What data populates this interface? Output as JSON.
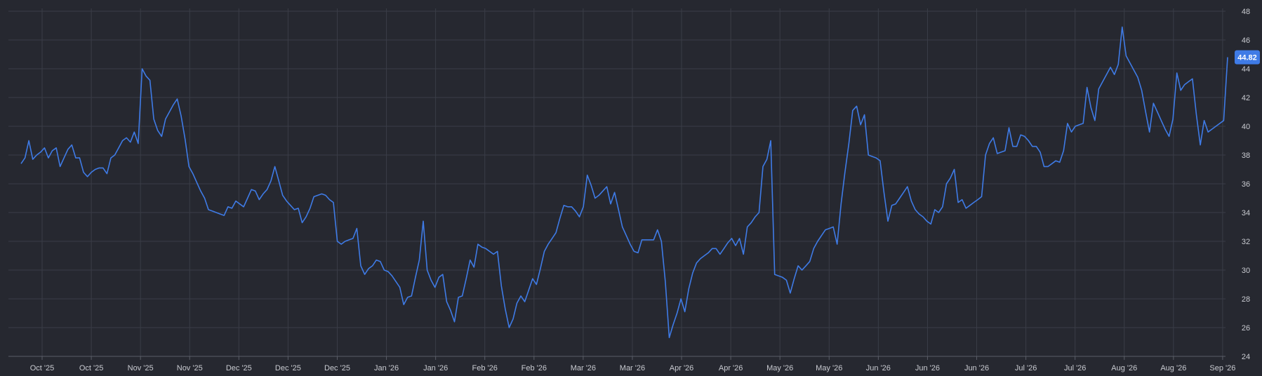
{
  "colors": {
    "background": "#262830",
    "line": "#3f7be6",
    "grid": "#3a3d47",
    "text": "#c9cbd1",
    "badge": "#3f7be6"
  },
  "chart_data": {
    "type": "line",
    "title": "",
    "xlabel": "",
    "ylabel": "",
    "ylim": [
      24,
      48
    ],
    "y_ticks": [
      24,
      26,
      28,
      30,
      32,
      34,
      36,
      38,
      40,
      42,
      44,
      46,
      48
    ],
    "y_axis_position": "right",
    "grid": true,
    "x_ticks": [
      "Oct '25",
      "Oct '25",
      "Nov '25",
      "Nov '25",
      "Dec '25",
      "Dec '25",
      "Dec '25",
      "Jan '26",
      "Jan '26",
      "Feb '26",
      "Feb '26",
      "Mar '26",
      "Mar '26",
      "Apr '26",
      "Apr '26",
      "May '26",
      "May '26",
      "Jun '26",
      "Jun '26",
      "Jun '26",
      "Jul '26",
      "Jul '26",
      "Aug '26",
      "Aug '26",
      "Sep '26"
    ],
    "last_value_label": "44.82",
    "series": [
      {
        "values": [
          37.4,
          37.8,
          39.0,
          37.7,
          38.0,
          38.2,
          38.5,
          37.8,
          38.3,
          38.5,
          37.2,
          37.8,
          38.4,
          38.7,
          37.8,
          37.8,
          36.8,
          36.5,
          36.8,
          37.0,
          37.1,
          37.1,
          36.7,
          37.8,
          38.0,
          38.5,
          39.0,
          39.2,
          38.9,
          39.6,
          38.8,
          44.0,
          43.5,
          43.2,
          40.5,
          39.7,
          39.3,
          40.5,
          41.0,
          41.5,
          41.9,
          40.7,
          39.1,
          37.2,
          36.7,
          36.1,
          35.5,
          35.0,
          34.2,
          34.1,
          34.0,
          33.9,
          33.8,
          34.4,
          34.3,
          34.8,
          34.6,
          34.4,
          35.0,
          35.6,
          35.5,
          34.9,
          35.3,
          35.6,
          36.2,
          37.2,
          36.2,
          35.2,
          34.8,
          34.5,
          34.2,
          34.3,
          33.3,
          33.7,
          34.3,
          35.1,
          35.2,
          35.3,
          35.2,
          34.9,
          34.7,
          32.0,
          31.8,
          32.0,
          32.1,
          32.2,
          32.9,
          30.3,
          29.7,
          30.1,
          30.3,
          30.7,
          30.6,
          30.0,
          29.9,
          29.6,
          29.2,
          28.8,
          27.6,
          28.1,
          28.2,
          29.5,
          30.7,
          33.4,
          30.0,
          29.3,
          28.8,
          29.5,
          29.7,
          27.8,
          27.2,
          26.4,
          28.1,
          28.2,
          29.4,
          30.7,
          30.2,
          31.8,
          31.6,
          31.5,
          31.3,
          31.1,
          31.3,
          28.9,
          27.3,
          26.0,
          26.6,
          27.7,
          28.2,
          27.8,
          28.6,
          29.4,
          29.0,
          30.1,
          31.3,
          31.8,
          32.2,
          32.6,
          33.6,
          34.5,
          34.4,
          34.4,
          34.1,
          33.7,
          34.4,
          36.6,
          35.9,
          35.0,
          35.2,
          35.5,
          35.8,
          34.6,
          35.4,
          34.2,
          33.0,
          32.4,
          31.8,
          31.3,
          31.2,
          32.1,
          32.1,
          32.1,
          32.1,
          32.8,
          32.0,
          29.2,
          25.3,
          26.2,
          27.0,
          28.0,
          27.1,
          28.7,
          29.8,
          30.5,
          30.8,
          31.0,
          31.2,
          31.5,
          31.5,
          31.1,
          31.5,
          31.9,
          32.2,
          31.7,
          32.2,
          31.1,
          33.0,
          33.3,
          33.7,
          34.0,
          37.2,
          37.7,
          39.0,
          29.7,
          29.6,
          29.5,
          29.3,
          28.4,
          29.4,
          30.3,
          30.0,
          30.3,
          30.6,
          31.5,
          32.0,
          32.4,
          32.8,
          32.9,
          33.0,
          31.8,
          34.6,
          36.8,
          38.8,
          41.1,
          41.4,
          40.1,
          40.8,
          38.0,
          37.9,
          37.8,
          37.6,
          35.4,
          33.4,
          34.5,
          34.6,
          35.0,
          35.4,
          35.8,
          34.8,
          34.2,
          33.9,
          33.7,
          33.4,
          33.2,
          34.2,
          34.0,
          34.4,
          36.0,
          36.4,
          37.0,
          34.7,
          34.9,
          34.3,
          34.5,
          34.7,
          34.9,
          35.1,
          38.0,
          38.8,
          39.2,
          38.1,
          38.2,
          38.3,
          39.9,
          38.6,
          38.6,
          39.4,
          39.3,
          39.0,
          38.6,
          38.6,
          38.2,
          37.2,
          37.2,
          37.4,
          37.6,
          37.5,
          38.3,
          40.2,
          39.6,
          40.0,
          40.1,
          40.2,
          42.7,
          41.3,
          40.4,
          42.6,
          43.1,
          43.6,
          44.1,
          43.6,
          44.3,
          46.9,
          44.9,
          44.4,
          43.9,
          43.4,
          42.5,
          41.0,
          39.6,
          41.6,
          41.0,
          40.4,
          39.8,
          39.3,
          40.5,
          43.7,
          42.5,
          42.9,
          43.1,
          43.3,
          40.8,
          38.7,
          40.4,
          39.6,
          39.8,
          40.0,
          40.2,
          40.4,
          44.8
        ]
      }
    ]
  }
}
